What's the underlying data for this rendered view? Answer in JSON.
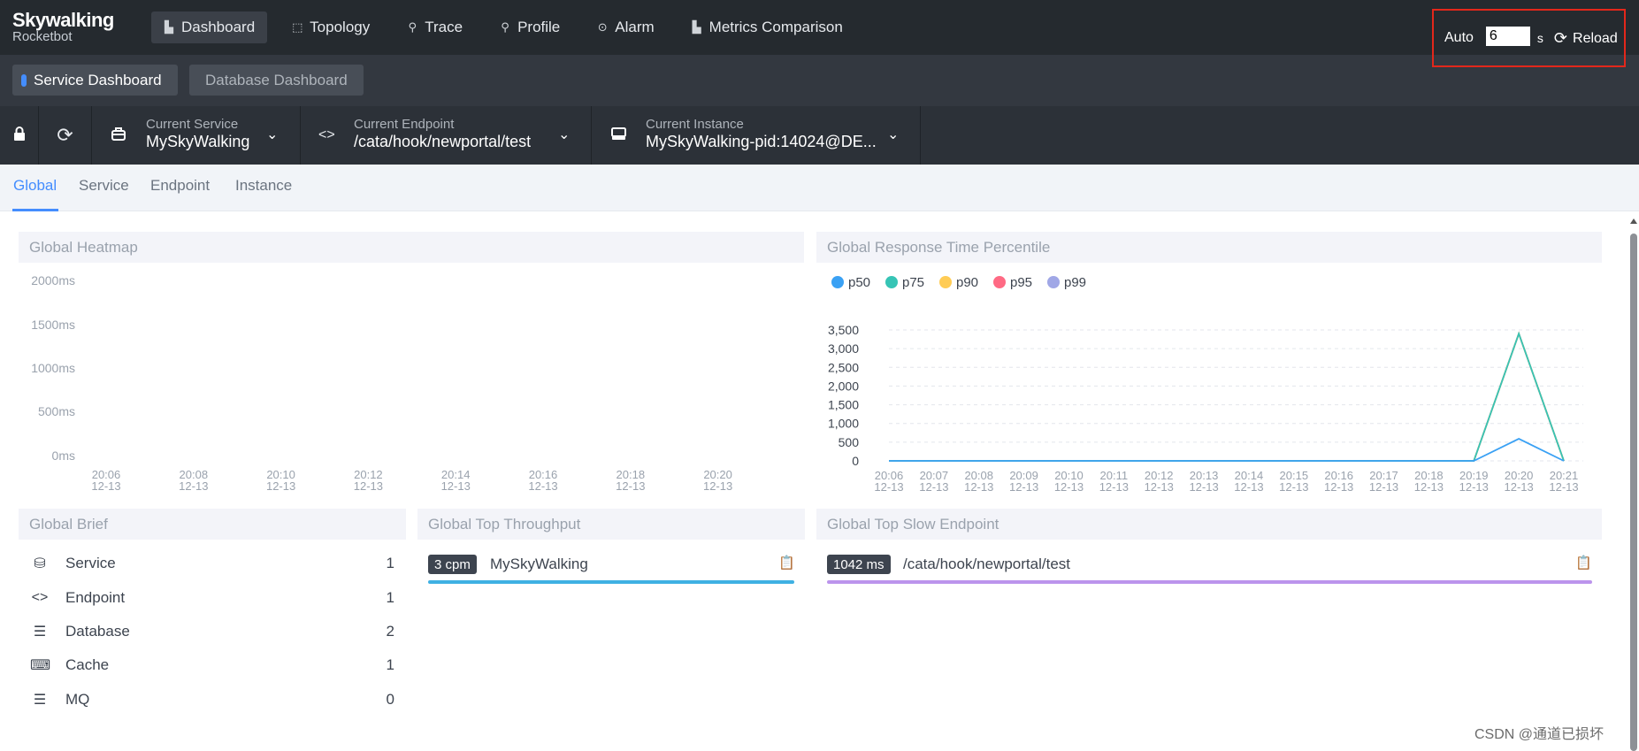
{
  "logo": {
    "line1": "Skywalking",
    "line2": "Rocketbot"
  },
  "nav": {
    "items": [
      {
        "label": "Dashboard",
        "icon": "bar-chart-icon",
        "glyph": "▙"
      },
      {
        "label": "Topology",
        "icon": "topology-icon",
        "glyph": "⬚"
      },
      {
        "label": "Trace",
        "icon": "trace-icon",
        "glyph": "⚲"
      },
      {
        "label": "Profile",
        "icon": "profile-icon",
        "glyph": "⚲"
      },
      {
        "label": "Alarm",
        "icon": "alarm-icon",
        "glyph": "⊙"
      },
      {
        "label": "Metrics Comparison",
        "icon": "bar-chart-icon",
        "glyph": "▙"
      }
    ]
  },
  "auto_refresh": {
    "label": "Auto",
    "interval": "6",
    "unit": "s",
    "reload_label": "Reload"
  },
  "dashboards": {
    "service": "Service Dashboard",
    "database": "Database Dashboard"
  },
  "selectors": {
    "service": {
      "label": "Current Service",
      "value": "MySkyWalking"
    },
    "endpoint": {
      "label": "Current Endpoint",
      "value": "/cata/hook/newportal/test"
    },
    "instance": {
      "label": "Current Instance",
      "value": "MySkyWalking-pid:14024@DE..."
    }
  },
  "subtabs": [
    "Global",
    "Service",
    "Endpoint",
    "Instance"
  ],
  "heatmap": {
    "title": "Global Heatmap",
    "y_labels": [
      "2000ms",
      "1500ms",
      "1000ms",
      "500ms",
      "0ms"
    ],
    "x_times": [
      "20:06",
      "20:08",
      "20:10",
      "20:12",
      "20:14",
      "20:16",
      "20:18",
      "20:20"
    ],
    "x_date": "12-13"
  },
  "percentile": {
    "title": "Global Response Time Percentile"
  },
  "chart_data": {
    "type": "line",
    "title": "Global Response Time Percentile",
    "x": [
      "20:06",
      "20:07",
      "20:08",
      "20:09",
      "20:10",
      "20:11",
      "20:12",
      "20:13",
      "20:14",
      "20:15",
      "20:16",
      "20:17",
      "20:18",
      "20:19",
      "20:20",
      "20:21"
    ],
    "x_date": "12-13",
    "yticks": [
      "3,500",
      "3,000",
      "2,500",
      "2,000",
      "1,500",
      "1,000",
      "500",
      "0"
    ],
    "ylim": [
      0,
      3500
    ],
    "legend_position": "top-left",
    "series": [
      {
        "name": "p50",
        "color": "#3aa1f4",
        "values": [
          0,
          0,
          0,
          0,
          0,
          0,
          0,
          0,
          0,
          0,
          0,
          0,
          0,
          0,
          590,
          0
        ]
      },
      {
        "name": "p75",
        "color": "#36c4b5",
        "values": [
          0,
          0,
          0,
          0,
          0,
          0,
          0,
          0,
          0,
          0,
          0,
          0,
          0,
          0,
          3400,
          0
        ]
      },
      {
        "name": "p90",
        "color": "#ffcc55",
        "values": [
          0,
          0,
          0,
          0,
          0,
          0,
          0,
          0,
          0,
          0,
          0,
          0,
          0,
          0,
          3400,
          0
        ]
      },
      {
        "name": "p95",
        "color": "#ff6a84",
        "values": [
          0,
          0,
          0,
          0,
          0,
          0,
          0,
          0,
          0,
          0,
          0,
          0,
          0,
          0,
          3400,
          0
        ]
      },
      {
        "name": "p99",
        "color": "#a0a7e6",
        "values": [
          0,
          0,
          0,
          0,
          0,
          0,
          0,
          0,
          0,
          0,
          0,
          0,
          0,
          0,
          3400,
          0
        ]
      }
    ]
  },
  "brief": {
    "title": "Global Brief",
    "rows": [
      {
        "label": "Service",
        "value": "1",
        "icon": "service-icon",
        "glyph": "⛁"
      },
      {
        "label": "Endpoint",
        "value": "1",
        "icon": "endpoint-icon",
        "glyph": "<>"
      },
      {
        "label": "Database",
        "value": "2",
        "icon": "database-icon",
        "glyph": "☰"
      },
      {
        "label": "Cache",
        "value": "1",
        "icon": "cache-icon",
        "glyph": "⌨"
      },
      {
        "label": "MQ",
        "value": "0",
        "icon": "mq-icon",
        "glyph": "☰"
      }
    ]
  },
  "throughput": {
    "title": "Global Top Throughput",
    "items": [
      {
        "badge": "3 cpm",
        "name": "MySkyWalking",
        "bar_color": "#3fb1e3",
        "fraction": 1.0
      }
    ]
  },
  "slow": {
    "title": "Global Top Slow Endpoint",
    "items": [
      {
        "badge": "1042 ms",
        "name": "/cata/hook/newportal/test",
        "bar_color": "#bb94ec",
        "fraction": 1.0
      }
    ]
  },
  "watermark": "CSDN @通道已损坏"
}
